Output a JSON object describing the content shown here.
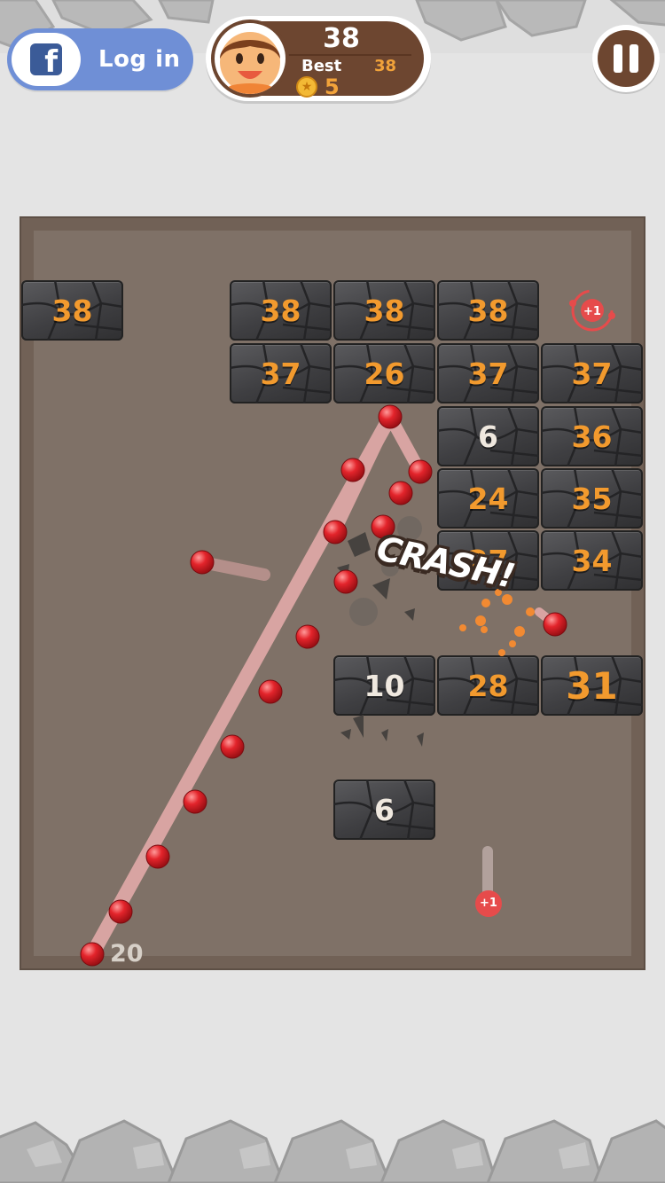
{
  "header": {
    "login_label": "Log in",
    "facebook_glyph": "f",
    "score": "38",
    "best_label": "Best",
    "best_value": "38",
    "coins": "5"
  },
  "board": {
    "ball_count": "20",
    "crash_label": "CRASH!",
    "plus_one_label": "+1",
    "bricks": [
      {
        "value": "38",
        "color": "orange"
      },
      {
        "value": "38",
        "color": "orange"
      },
      {
        "value": "38",
        "color": "orange"
      },
      {
        "value": "38",
        "color": "orange"
      },
      {
        "value": "37",
        "color": "orange"
      },
      {
        "value": "26",
        "color": "orange"
      },
      {
        "value": "37",
        "color": "orange"
      },
      {
        "value": "37",
        "color": "orange"
      },
      {
        "value": "6",
        "color": "white"
      },
      {
        "value": "36",
        "color": "orange"
      },
      {
        "value": "24",
        "color": "orange"
      },
      {
        "value": "35",
        "color": "orange"
      },
      {
        "value": "27",
        "color": "orange"
      },
      {
        "value": "34",
        "color": "orange"
      },
      {
        "value": "10",
        "color": "white"
      },
      {
        "value": "28",
        "color": "orange"
      },
      {
        "value": "31",
        "color": "orange"
      },
      {
        "value": "6",
        "color": "white"
      }
    ]
  },
  "colors": {
    "background": "#e4e4e4",
    "board": "#7f7167",
    "brick_number": "#f29a2e",
    "ball": "#e0212a",
    "hud_brown": "#6d4630",
    "facebook_blue": "#6f8fd6"
  },
  "icons": {
    "facebook": "facebook-icon",
    "pause": "pause-icon",
    "coin": "star-coin-icon",
    "avatar": "character-avatar"
  }
}
